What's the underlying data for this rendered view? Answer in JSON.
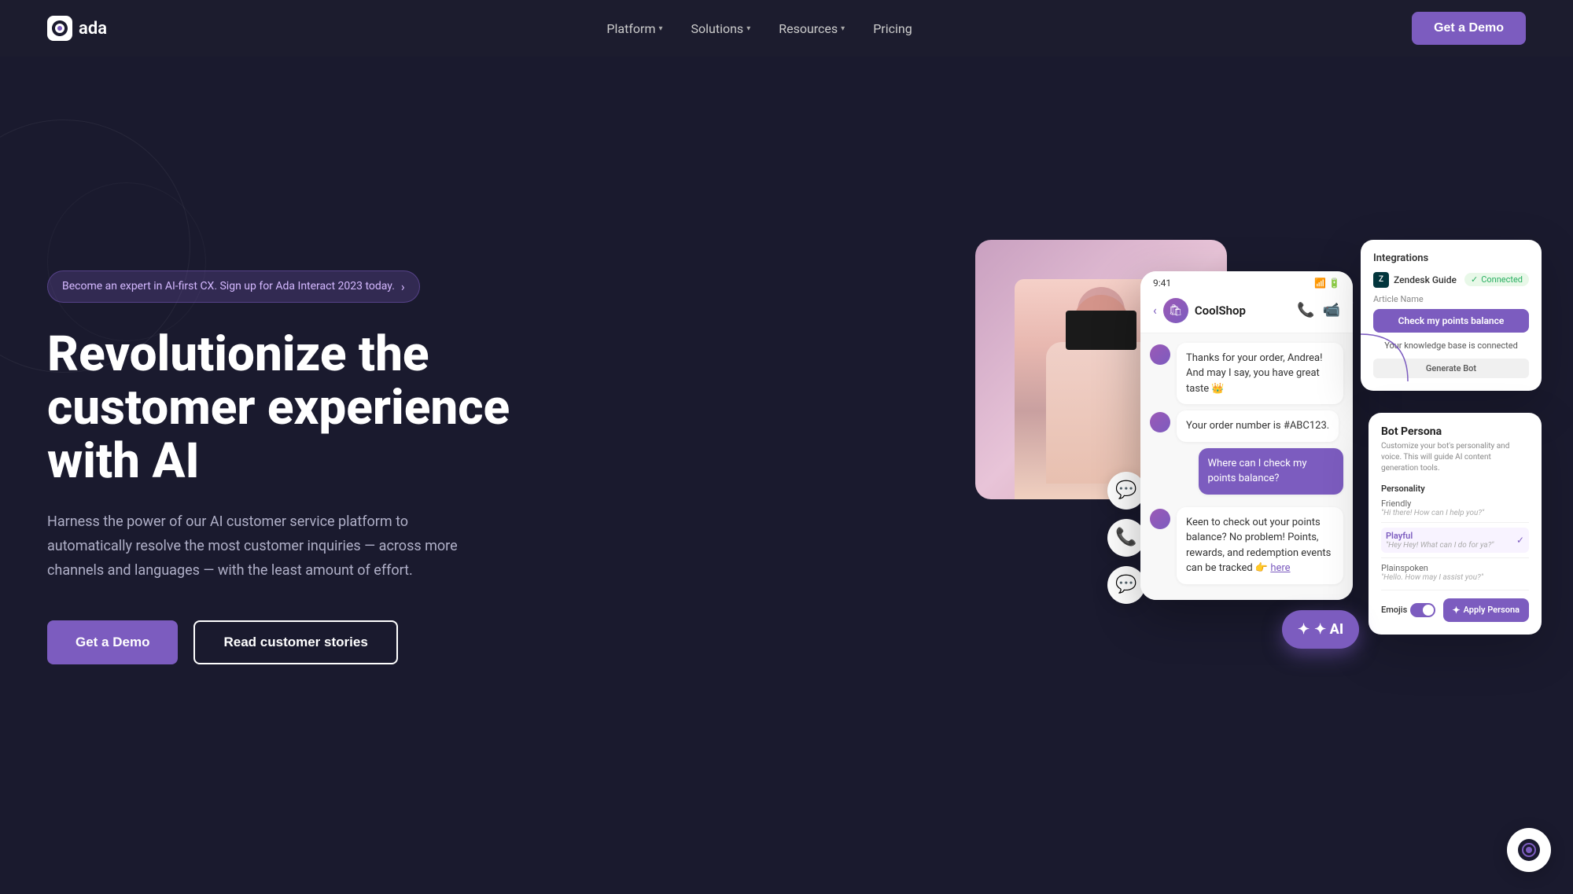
{
  "nav": {
    "logo_text": "ada",
    "links": [
      {
        "label": "Platform",
        "has_dropdown": true
      },
      {
        "label": "Solutions",
        "has_dropdown": true
      },
      {
        "label": "Resources",
        "has_dropdown": true
      },
      {
        "label": "Pricing",
        "has_dropdown": false
      }
    ],
    "cta_label": "Get a Demo"
  },
  "hero": {
    "badge_text": "Become an expert in AI-first CX. Sign up for Ada Interact 2023 today.",
    "title": "Revolutionize the customer experience with AI",
    "description": "Harness the power of our AI customer service platform to automatically resolve the most customer inquiries — across more channels and languages — with the least amount of effort.",
    "btn_primary": "Get a Demo",
    "btn_secondary": "Read customer stories"
  },
  "chat_ui": {
    "time": "9:41",
    "shop_name": "CoolShop",
    "messages": [
      {
        "type": "bot",
        "text": "Thanks for your order, Andrea! And may I say, you have great taste 👑"
      },
      {
        "type": "bot",
        "text": "Your order number is #ABC123."
      },
      {
        "type": "user",
        "text": "Where can I check my points balance?"
      },
      {
        "type": "bot",
        "text": "Keen to check out your points balance? No problem! Points, rewards, and redemption events can be tracked 👉 here"
      }
    ]
  },
  "integrations_card": {
    "title": "Integrations",
    "zendesk_name": "Zendesk Guide",
    "connected_label": "Connected",
    "article_name_label": "Article Name",
    "article_name_value": "Check my points balance",
    "kb_text": "Your knowledge base is connected",
    "generate_btn": "Generate Bot"
  },
  "persona_card": {
    "title": "Bot Persona",
    "desc": "Customize your bot's personality and voice. This will guide AI content generation tools.",
    "personality_label": "Personality",
    "options": [
      {
        "name": "Friendly",
        "preview": "\"Hi there! How can I help you?\"",
        "selected": false
      },
      {
        "name": "Playful",
        "preview": "\"Hey Hey! What can I do for ya?\"",
        "selected": true
      },
      {
        "name": "Plainspoken",
        "preview": "\"Hello. How may I assist you?\"",
        "selected": false
      }
    ],
    "emojis_label": "Emojis",
    "apply_btn": "✦ Apply Persona"
  },
  "channels": [
    {
      "icon": "💬",
      "name": "messenger"
    },
    {
      "icon": "📞",
      "name": "phone"
    },
    {
      "icon": "💬",
      "name": "sms"
    }
  ],
  "ai_badge": "✦ AI",
  "chatbot_icon": "🤖"
}
